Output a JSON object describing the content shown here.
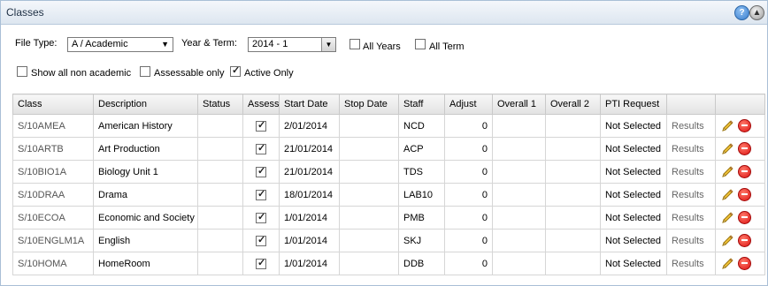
{
  "panel": {
    "title": "Classes"
  },
  "filters": {
    "file_type_label": "File Type:",
    "file_type_value": "A / Academic",
    "year_term_label": "Year & Term:",
    "year_term_value": "2014 - 1",
    "all_years_label": "All Years",
    "all_years_checked": false,
    "all_term_label": "All Term",
    "all_term_checked": false,
    "show_non_academic_label": "Show all non academic",
    "show_non_academic_checked": false,
    "assessable_only_label": "Assessable only",
    "assessable_only_checked": false,
    "active_only_label": "Active Only",
    "active_only_checked": true
  },
  "table": {
    "columns": [
      "Class",
      "Description",
      "Status",
      "Assess",
      "Start Date",
      "Stop Date",
      "Staff",
      "Adjust",
      "Overall 1",
      "Overall 2",
      "PTI Request",
      "",
      ""
    ],
    "rows": [
      {
        "class": "S/10AMEA",
        "description": "American History",
        "status": "",
        "assess": true,
        "start": "2/01/2014",
        "stop": "",
        "staff": "NCD",
        "adjust": "0",
        "overall1": "",
        "overall2": "",
        "pti": "Not Selected",
        "results": "Results"
      },
      {
        "class": "S/10ARTB",
        "description": "Art Production",
        "status": "",
        "assess": true,
        "start": "21/01/2014",
        "stop": "",
        "staff": "ACP",
        "adjust": "0",
        "overall1": "",
        "overall2": "",
        "pti": "Not Selected",
        "results": "Results"
      },
      {
        "class": "S/10BIO1A",
        "description": "Biology Unit 1",
        "status": "",
        "assess": true,
        "start": "21/01/2014",
        "stop": "",
        "staff": "TDS",
        "adjust": "0",
        "overall1": "",
        "overall2": "",
        "pti": "Not Selected",
        "results": "Results"
      },
      {
        "class": "S/10DRAA",
        "description": "Drama",
        "status": "",
        "assess": true,
        "start": "18/01/2014",
        "stop": "",
        "staff": "LAB10",
        "adjust": "0",
        "overall1": "",
        "overall2": "",
        "pti": "Not Selected",
        "results": "Results"
      },
      {
        "class": "S/10ECOA",
        "description": "Economic and Society",
        "status": "",
        "assess": true,
        "start": "1/01/2014",
        "stop": "",
        "staff": "PMB",
        "adjust": "0",
        "overall1": "",
        "overall2": "",
        "pti": "Not Selected",
        "results": "Results"
      },
      {
        "class": "S/10ENGLM1A",
        "description": "English",
        "status": "",
        "assess": true,
        "start": "1/01/2014",
        "stop": "",
        "staff": "SKJ",
        "adjust": "0",
        "overall1": "",
        "overall2": "",
        "pti": "Not Selected",
        "results": "Results"
      },
      {
        "class": "S/10HOMA",
        "description": "HomeRoom",
        "status": "",
        "assess": true,
        "start": "1/01/2014",
        "stop": "",
        "staff": "DDB",
        "adjust": "0",
        "overall1": "",
        "overall2": "",
        "pti": "Not Selected",
        "results": "Results"
      }
    ]
  },
  "icons": {
    "help": "help-icon",
    "collapse": "collapse-up-icon",
    "edit": "pencil-icon",
    "delete": "delete-icon"
  },
  "colors": {
    "title_bg": "#dde6f0",
    "delete": "#d11111",
    "pencil": "#e8b830"
  }
}
